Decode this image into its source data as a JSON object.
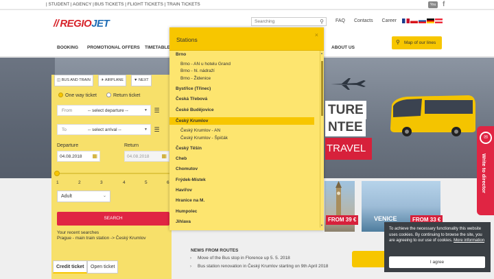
{
  "topbar": {
    "student": "| STUDENT | AGENCY |",
    "links": "BUS TICKETS  |  FLIGHT TICKETS  |  TRAIN TICKETS",
    "youtube": "You",
    "facebook": "f"
  },
  "header": {
    "logo_bars": "//",
    "logo_regio": "REGIO",
    "logo_jet": "JET",
    "search_placeholder": "Searching",
    "links": [
      "FAQ",
      "Contacts",
      "Career"
    ],
    "nav": [
      "BOOKING",
      "PROMOTIONAL OFFERS",
      "TIMETABLES",
      "ABOUT US"
    ],
    "map_button": "Map of our lines"
  },
  "hero": {
    "line1": "TURE",
    "line2": "NTEE",
    "line3": "TRAVEL"
  },
  "booking": {
    "tabs": [
      "BUS AND TRAIN",
      "AIRPLANE",
      "NEXT"
    ],
    "trip_types": [
      "One way ticket",
      "Return ticket"
    ],
    "from_label": "From",
    "from_value": "-- select departure --",
    "to_label": "To",
    "to_value": "-- select arrival --",
    "departure_label": "Departure",
    "departure_value": "04.08.2018",
    "return_label": "Return",
    "return_value": "04.08.2018",
    "passenger_ticks": [
      "1",
      "2",
      "3",
      "4",
      "5",
      "6"
    ],
    "passenger_type": "Adult",
    "search_button": "SEARCH",
    "recent_label": "Your recent searches",
    "recent_item": "Prague - main train station -> Český Krumlov"
  },
  "bottom_tabs": [
    "Credit ticket",
    "Open ticket"
  ],
  "offers": {
    "price1": "FROM 39 €",
    "city2": "VENICE",
    "price2": "FROM 33 €"
  },
  "news": {
    "heading": "NEWS FROM ROUTES",
    "items": [
      "Move of the Bus stop in Florence up 5. 5. 2018",
      "Bus station renovation in Český Krumlov starting on 9th April 2018"
    ]
  },
  "side_tab": {
    "label": "Write to director"
  },
  "cookie": {
    "text": "To achieve the necessary functionality this website uses cookies. By continuing to browse the site, you are agreeing to our use of cookies.",
    "link": "More information",
    "button": "I agree"
  },
  "modal": {
    "title": "Stations",
    "close": "×",
    "rows": [
      {
        "type": "city",
        "label": "Brno"
      },
      {
        "type": "stop",
        "label": "Brno - AN u hotelu Grand"
      },
      {
        "type": "stop",
        "label": "Brno - hl. nádraží"
      },
      {
        "type": "stop",
        "label": "Brno - Židenice"
      },
      {
        "type": "city",
        "label": "Bystřice (Třinec)"
      },
      {
        "type": "city",
        "label": "Česká Třebová"
      },
      {
        "type": "city",
        "label": "České Budějovice"
      },
      {
        "type": "city",
        "label": "Český Krumlov",
        "highlighted": true
      },
      {
        "type": "stop",
        "label": "Český Krumlov - AN"
      },
      {
        "type": "stop",
        "label": "Český Krumlov - Špičák"
      },
      {
        "type": "city",
        "label": "Český Těšín"
      },
      {
        "type": "city",
        "label": "Cheb"
      },
      {
        "type": "city",
        "label": "Chomutov"
      },
      {
        "type": "city",
        "label": "Frýdek-Místek"
      },
      {
        "type": "city",
        "label": "Havířov"
      },
      {
        "type": "city",
        "label": "Hranice na M."
      },
      {
        "type": "city",
        "label": "Humpolec"
      },
      {
        "type": "city",
        "label": "Jihlava"
      }
    ]
  },
  "colors": {
    "brand_red": "#d72229",
    "brand_yellow": "#f7c600",
    "search_red": "#e02543"
  }
}
